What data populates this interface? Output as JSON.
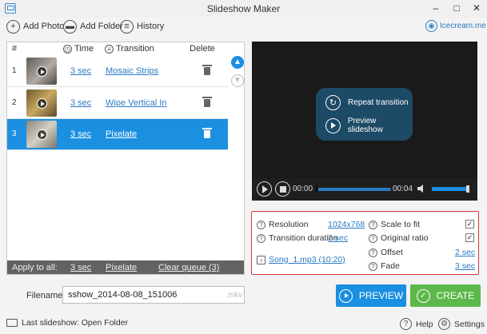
{
  "window": {
    "title": "Slideshow Maker",
    "controls": [
      "–",
      "□",
      "✕"
    ]
  },
  "toolbar": {
    "add_photo": "Add Photo",
    "add_folder": "Add Folder",
    "history": "History",
    "brand": "Icecream.me"
  },
  "table": {
    "headers": {
      "num": "#",
      "time": "Time",
      "transition": "Transition",
      "delete": "Delete"
    },
    "rows": [
      {
        "num": "1",
        "time": "3 sec",
        "transition": "Mosaic Strips",
        "thumb_color": "#7f7a76"
      },
      {
        "num": "2",
        "time": "3 sec",
        "transition": "Wipe Vertical In",
        "thumb_color": "#8d7d4f"
      },
      {
        "num": "3",
        "time": "3 sec",
        "transition": "Pixelate",
        "thumb_color": "#a39f95"
      }
    ],
    "selected_row": 3
  },
  "apply_all": {
    "label": "Apply to all:",
    "time": "3 sec",
    "transition": "Pixelate",
    "clear": "Clear queue (3)"
  },
  "player": {
    "repeat": "Repeat transition",
    "preview": "Preview slideshow",
    "current_time": "00:00",
    "duration": "00:04"
  },
  "settings": {
    "resolution_label": "Resolution",
    "resolution_value": "1024x768",
    "transition_duration_label": "Transition duration",
    "transition_duration_value": "2 sec",
    "audio": "Song_1.mp3 (10:20)",
    "scale_to_fit_label": "Scale to fit",
    "scale_to_fit_checked": "✓",
    "original_ratio_label": "Original ratio",
    "original_ratio_checked": "✓",
    "offset_label": "Offset",
    "offset_value": "2 sec",
    "fade_label": "Fade",
    "fade_value": "3 sec"
  },
  "output": {
    "filename_label": "Filename:",
    "filename_value": "sshow_2014-08-08_151006",
    "extension": ".mkv",
    "preview_button": "PREVIEW",
    "create_button": "CREATE"
  },
  "status": {
    "last_slideshow": "Last slideshow: Open Folder",
    "help": "Help",
    "settings": "Settings"
  },
  "colors": {
    "accent": "#1b8fe0",
    "link": "#2a7ac4",
    "create": "#5cb84a",
    "highlight_box": "#d43a3a"
  }
}
